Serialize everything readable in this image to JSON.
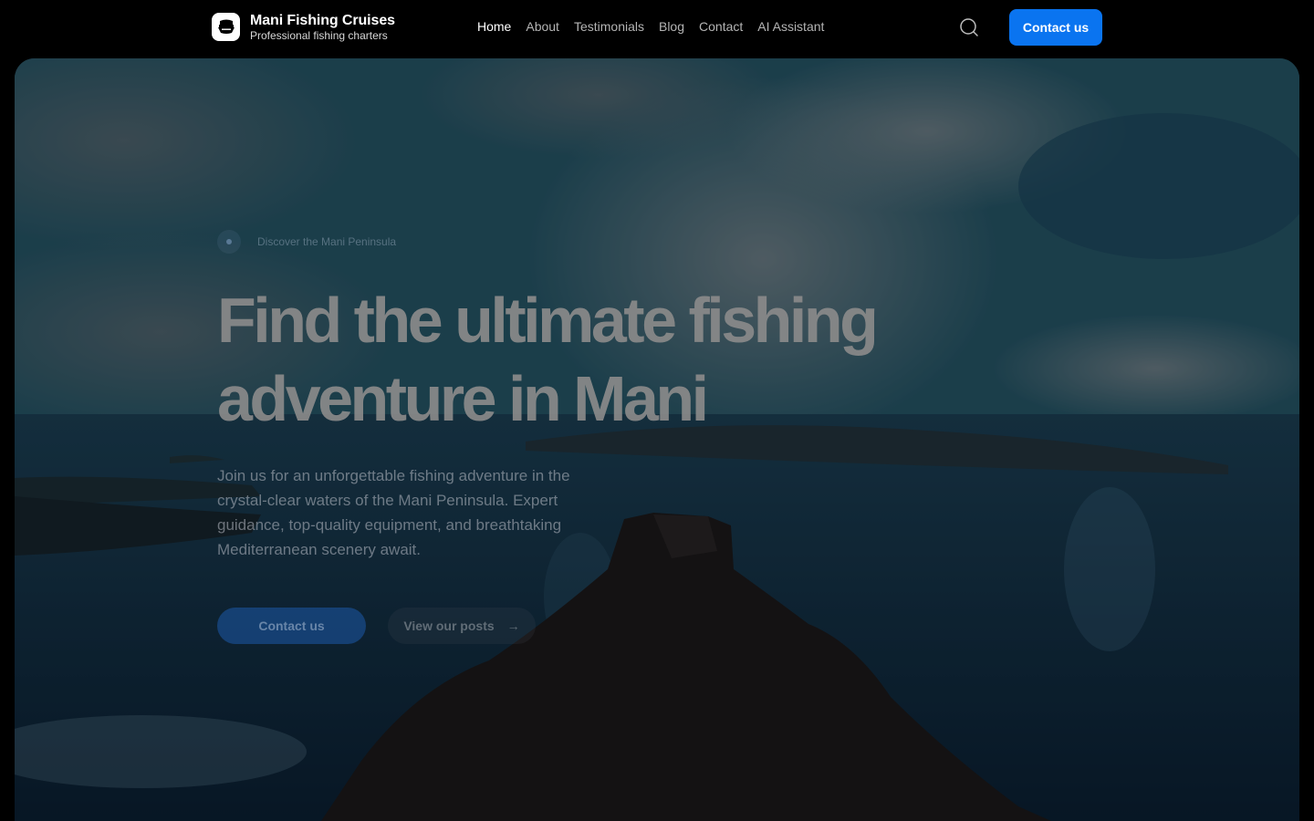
{
  "header": {
    "brand_name": "Mani Fishing Cruises",
    "brand_tagline": "Professional fishing charters",
    "logo_icon": "boat-logo-icon",
    "nav": [
      {
        "label": "Home",
        "active": true
      },
      {
        "label": "About",
        "active": false
      },
      {
        "label": "Testimonials",
        "active": false
      },
      {
        "label": "Blog",
        "active": false
      },
      {
        "label": "Contact",
        "active": false
      },
      {
        "label": "AI Assistant",
        "active": false
      }
    ],
    "search_icon": "search-icon",
    "cta_label": "Contact us"
  },
  "hero": {
    "eyebrow": "Discover the Mani Peninsula",
    "title": "Find the ultimate fishing adventure in Mani",
    "subtitle": "Join us for an unforgettable fishing adventure in the crystal-clear waters of the Mani Peninsula. Expert guidance, top-quality equipment, and breathtaking Mediterranean scenery await.",
    "primary_cta": "Contact us",
    "secondary_cta": "View our posts",
    "secondary_icon": "arrow-right-icon"
  },
  "colors": {
    "accent": "#0a74f0",
    "header_bg": "#000000"
  }
}
